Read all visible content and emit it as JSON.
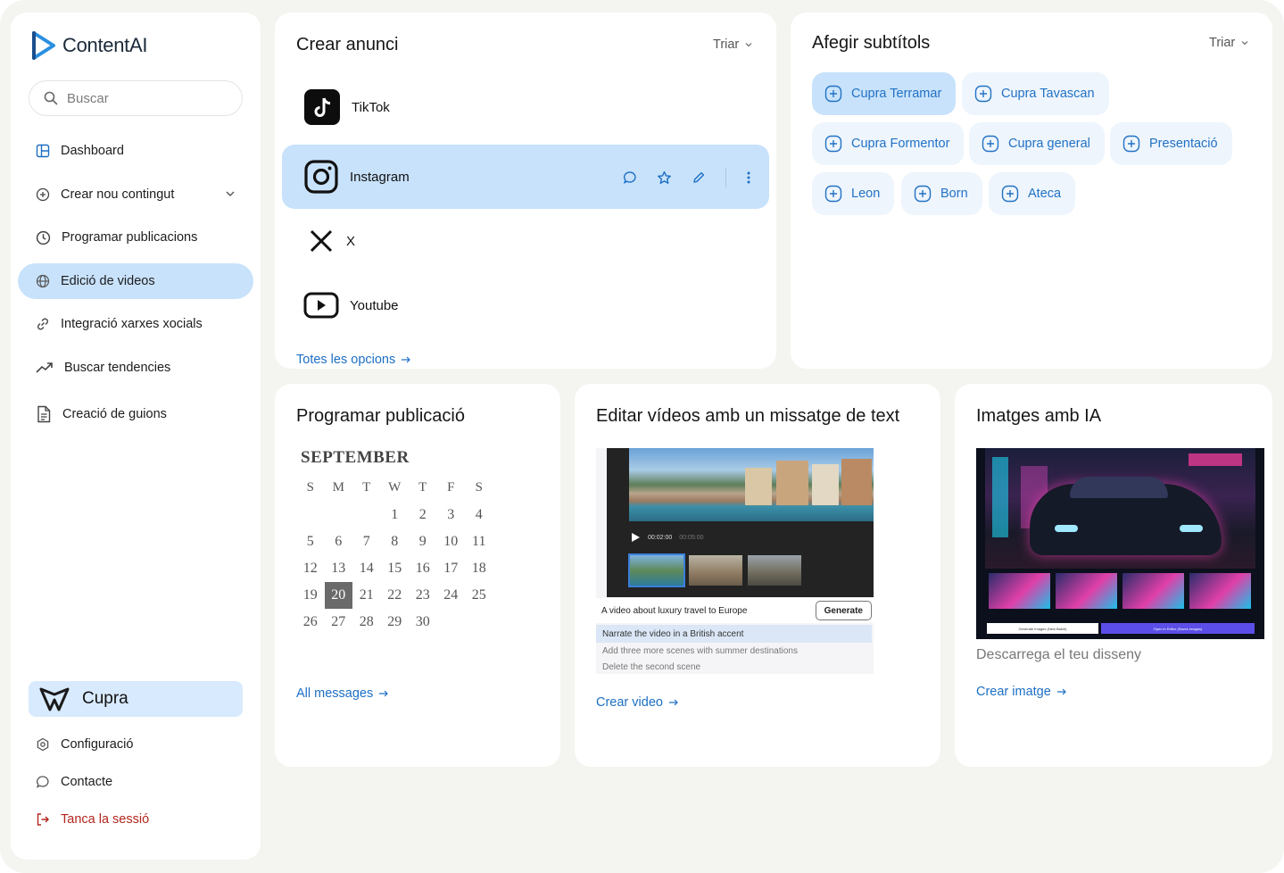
{
  "app": {
    "name": "ContentAI"
  },
  "sidebar": {
    "search_placeholder": "Buscar",
    "items": [
      {
        "label": "Dashboard",
        "icon": "dashboard-icon"
      },
      {
        "label": "Crear nou contingut",
        "icon": "plus-circle-icon"
      },
      {
        "label": "Programar publicacions",
        "icon": "clock-icon"
      },
      {
        "label": "Edició de videos",
        "icon": "globe-icon",
        "active": true
      },
      {
        "label": "Integració xarxes xocials",
        "icon": "link-icon"
      },
      {
        "label": "Buscar tendencies",
        "icon": "trend-icon"
      },
      {
        "label": "Creació de guions",
        "icon": "document-icon"
      }
    ],
    "brand": {
      "name": "Cupra"
    },
    "footer": [
      {
        "label": "Configuració",
        "icon": "settings-icon"
      },
      {
        "label": "Contacte",
        "icon": "chat-icon"
      },
      {
        "label": "Tanca la sessió",
        "icon": "logout-icon"
      }
    ]
  },
  "create_ad": {
    "title": "Crear anunci",
    "sort_label": "Triar",
    "platforms": [
      {
        "label": "TikTok"
      },
      {
        "label": "Instagram",
        "active": true
      },
      {
        "label": "X"
      },
      {
        "label": "Youtube"
      }
    ],
    "link": "Totes les opcions"
  },
  "subtitles": {
    "title": "Afegir subtítols",
    "sort_label": "Triar",
    "chips": [
      {
        "label": "Cupra Terramar",
        "active": true
      },
      {
        "label": "Cupra Tavascan"
      },
      {
        "label": "Cupra Formentor"
      },
      {
        "label": "Cupra general"
      },
      {
        "label": "Presentació"
      },
      {
        "label": "Leon"
      },
      {
        "label": "Born"
      },
      {
        "label": "Ateca"
      }
    ]
  },
  "schedule": {
    "title": "Programar publicació",
    "calendar": {
      "month": "SEPTEMBER",
      "weekdays": [
        "S",
        "M",
        "T",
        "W",
        "T",
        "F",
        "S"
      ],
      "leading_blanks": 3,
      "days": 30,
      "selected": 20
    },
    "link": "All messages"
  },
  "edit_video": {
    "title": "Editar vídeos amb un missatge de text",
    "mock": {
      "time_current": "00:02:00",
      "time_total": "00:05:00",
      "prompt": "A video about luxury travel to Europe",
      "generate_label": "Generate",
      "suggestions": [
        "Narrate the video in a British accent",
        "Add three more scenes with summer destinations",
        "Delete the second scene"
      ]
    },
    "link": "Crear video"
  },
  "ai_images": {
    "title": "Imatges amb IA",
    "mock": {
      "left_button": "Generate Images (New Batch)",
      "right_button": "Open in Editor (Saves Images)"
    },
    "caption": "Descarrega el teu disseny",
    "link": "Crear imatge"
  },
  "colors": {
    "accent": "#1d6fc4",
    "active_bg": "#c8e2fb",
    "chip_bg": "#eef5fd",
    "logout": "#b3261e",
    "canvas": "#f4f4f0"
  }
}
